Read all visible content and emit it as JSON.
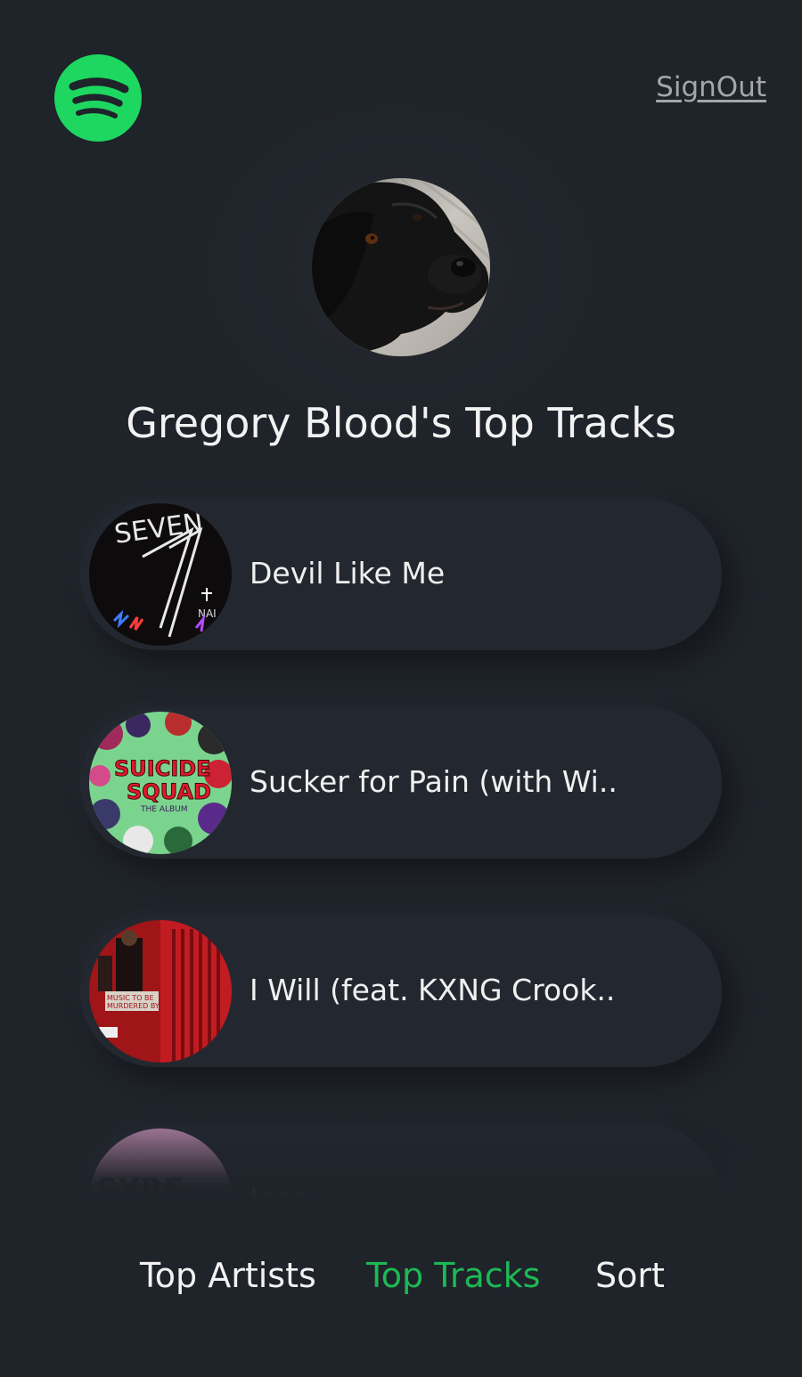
{
  "header": {
    "signout_label": "SignOut"
  },
  "profile": {
    "title": "Gregory Blood's Top Tracks"
  },
  "tracks": [
    {
      "name": "Devil Like Me"
    },
    {
      "name": "Sucker for Pain (with Wi.."
    },
    {
      "name": "I Will (feat. KXNG Crook.."
    },
    {
      "name": "Icon"
    }
  ],
  "nav": {
    "items": [
      {
        "label": "Top Artists",
        "active": false
      },
      {
        "label": "Top Tracks",
        "active": true
      },
      {
        "label": "Sort",
        "active": false
      }
    ]
  },
  "colors": {
    "background": "#1f232a",
    "accent": "#1db954",
    "card": "#232830"
  },
  "icons": {
    "logo": "spotify-logo-icon"
  }
}
